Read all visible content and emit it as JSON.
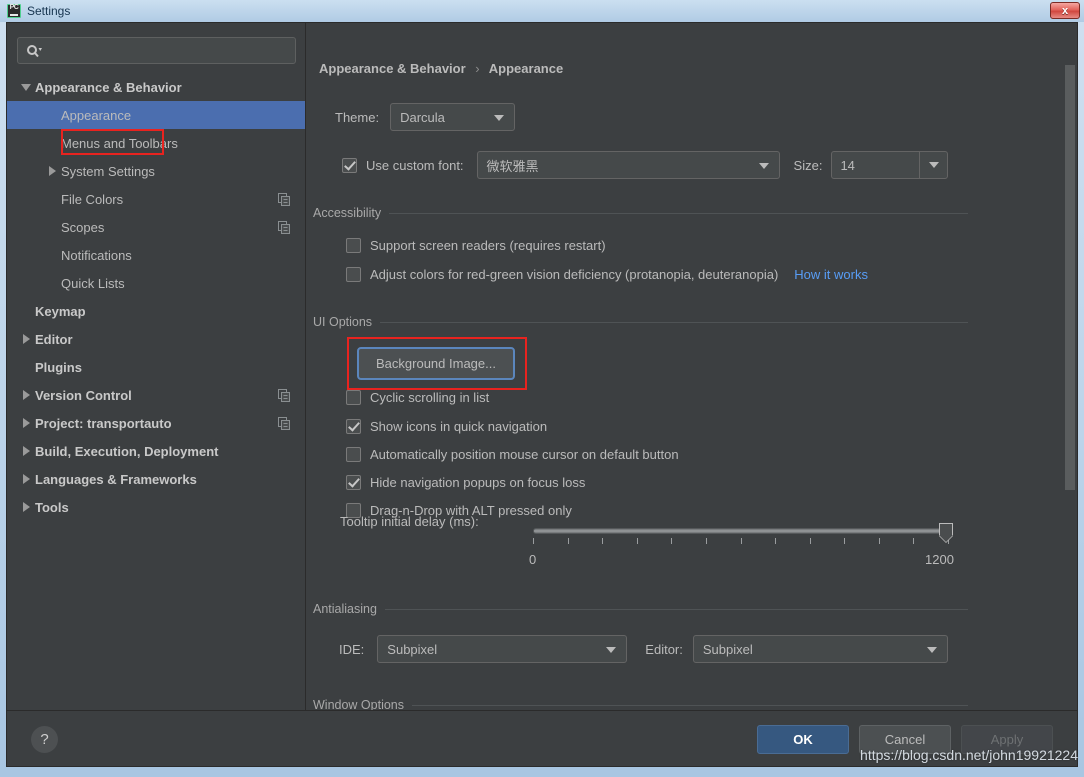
{
  "window": {
    "title": "Settings",
    "app_icon": "pycharm-icon",
    "close_label": "x"
  },
  "sidebar": {
    "search": {
      "placeholder": "",
      "value": "",
      "icon": "search-icon"
    },
    "items": [
      {
        "label": "Appearance & Behavior",
        "indent": 0,
        "twisty": "down",
        "bold": true,
        "selected": false,
        "copy": false
      },
      {
        "label": "Appearance",
        "indent": 1,
        "twisty": "none",
        "bold": false,
        "selected": true,
        "copy": false
      },
      {
        "label": "Menus and Toolbars",
        "indent": 1,
        "twisty": "none",
        "bold": false,
        "selected": false,
        "copy": false
      },
      {
        "label": "System Settings",
        "indent": 1,
        "twisty": "right",
        "bold": false,
        "selected": false,
        "copy": false
      },
      {
        "label": "File Colors",
        "indent": 1,
        "twisty": "none",
        "bold": false,
        "selected": false,
        "copy": true
      },
      {
        "label": "Scopes",
        "indent": 1,
        "twisty": "none",
        "bold": false,
        "selected": false,
        "copy": true
      },
      {
        "label": "Notifications",
        "indent": 1,
        "twisty": "none",
        "bold": false,
        "selected": false,
        "copy": false
      },
      {
        "label": "Quick Lists",
        "indent": 1,
        "twisty": "none",
        "bold": false,
        "selected": false,
        "copy": false
      },
      {
        "label": "Keymap",
        "indent": 0,
        "twisty": "none",
        "bold": true,
        "selected": false,
        "copy": false
      },
      {
        "label": "Editor",
        "indent": 0,
        "twisty": "right",
        "bold": true,
        "selected": false,
        "copy": false
      },
      {
        "label": "Plugins",
        "indent": 0,
        "twisty": "none",
        "bold": true,
        "selected": false,
        "copy": false
      },
      {
        "label": "Version Control",
        "indent": 0,
        "twisty": "right",
        "bold": true,
        "selected": false,
        "copy": true
      },
      {
        "label": "Project: transportauto",
        "indent": 0,
        "twisty": "right",
        "bold": true,
        "selected": false,
        "copy": true
      },
      {
        "label": "Build, Execution, Deployment",
        "indent": 0,
        "twisty": "right",
        "bold": true,
        "selected": false,
        "copy": false
      },
      {
        "label": "Languages & Frameworks",
        "indent": 0,
        "twisty": "right",
        "bold": true,
        "selected": false,
        "copy": false
      },
      {
        "label": "Tools",
        "indent": 0,
        "twisty": "right",
        "bold": true,
        "selected": false,
        "copy": false
      }
    ]
  },
  "content": {
    "breadcrumb": {
      "parent": "Appearance & Behavior",
      "separator": "›",
      "current": "Appearance"
    },
    "theme": {
      "label": "Theme:",
      "value": "Darcula"
    },
    "custom_font": {
      "checkbox_label": "Use custom font:",
      "checked": true,
      "font_value": "微软雅黑",
      "size_label": "Size:",
      "size_value": "14"
    },
    "accessibility": {
      "section_title": "Accessibility",
      "options": [
        {
          "label": "Support screen readers (requires restart)",
          "checked": false
        },
        {
          "label": "Adjust colors for red-green vision deficiency (protanopia, deuteranopia)",
          "checked": false
        }
      ],
      "link": "How it works"
    },
    "ui_options": {
      "section_title": "UI Options",
      "background_image_button": "Background Image...",
      "options": [
        {
          "label": "Cyclic scrolling in list",
          "checked": false
        },
        {
          "label": "Show icons in quick navigation",
          "checked": true
        },
        {
          "label": "Automatically position mouse cursor on default button",
          "checked": false
        },
        {
          "label": "Hide navigation popups on focus loss",
          "checked": true
        },
        {
          "label": "Drag-n-Drop with ALT pressed only",
          "checked": false
        }
      ],
      "tooltip_delay": {
        "label": "Tooltip initial delay (ms):",
        "min_label": "0",
        "max_label": "1200",
        "min": 0,
        "max": 1200,
        "value": 1200,
        "tick_count": 13
      }
    },
    "antialiasing": {
      "section_title": "Antialiasing",
      "ide_label": "IDE:",
      "ide_value": "Subpixel",
      "editor_label": "Editor:",
      "editor_value": "Subpixel"
    },
    "window_options": {
      "section_title": "Window Options"
    }
  },
  "footer": {
    "help": "?",
    "ok": "OK",
    "cancel": "Cancel",
    "apply": "Apply"
  },
  "watermark": "https://blog.csdn.net/john19921224",
  "colors": {
    "dialog_bg": "#3c3f41",
    "selection_blue": "#4b6eaf",
    "primary_button": "#365880",
    "focus_ring": "#5b86bd",
    "annotation_red": "#e8231f",
    "link_blue": "#589df6"
  }
}
